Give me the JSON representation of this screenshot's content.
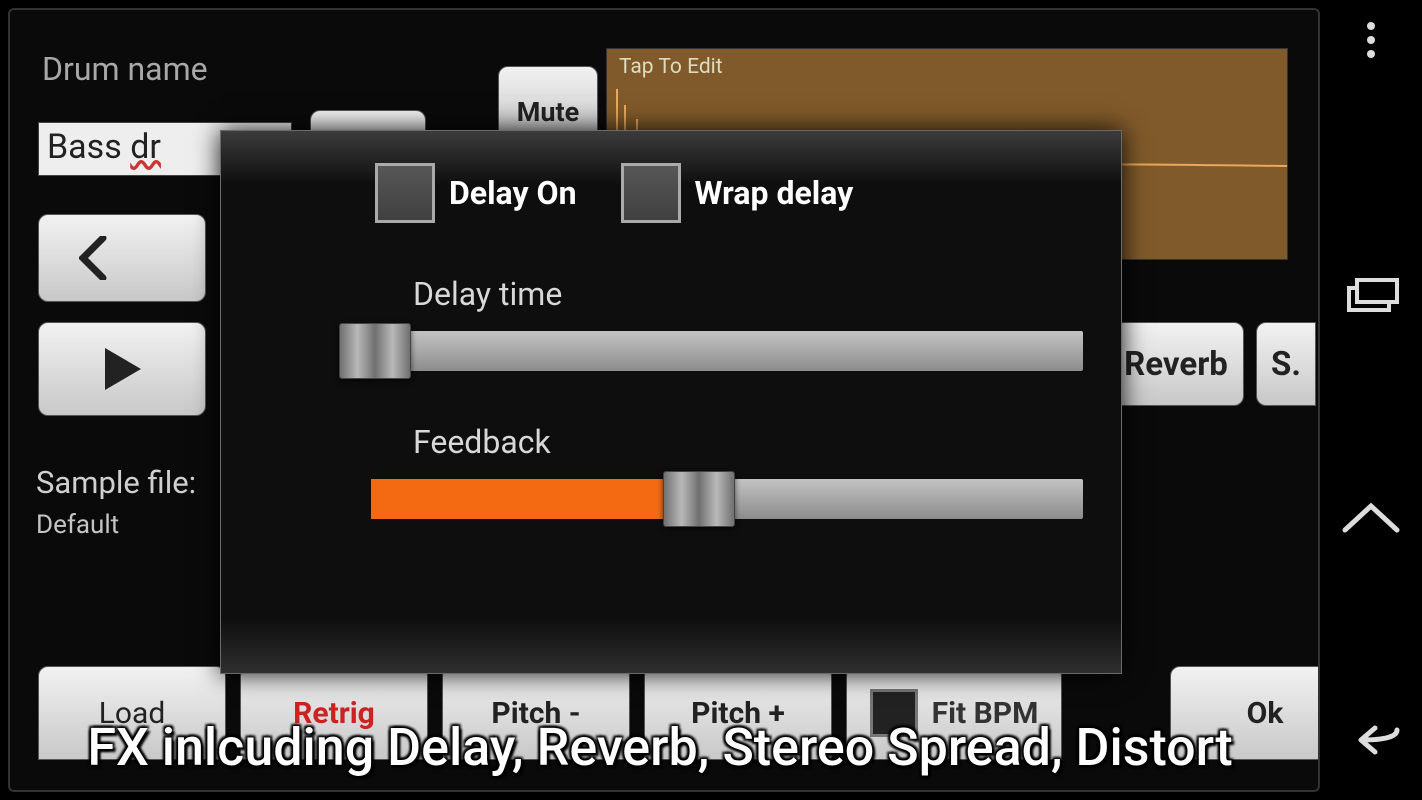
{
  "header": {
    "drum_name_label": "Drum name",
    "drum_name_value_pre": "Bass ",
    "drum_name_value_typo": "dr",
    "mute_label": "Mute"
  },
  "waveform": {
    "hint": "Tap To Edit"
  },
  "fx_tabs": {
    "reverb": "Reverb",
    "s": "S."
  },
  "sample": {
    "label": "Sample file:",
    "value": "Default"
  },
  "bottom": {
    "load": "Load",
    "retrig": "Retrig",
    "pitch_minus": "Pitch -",
    "pitch_plus": "Pitch +",
    "fit_bpm": "Fit BPM",
    "ok": "Ok"
  },
  "dialog": {
    "delay_on": "Delay On",
    "wrap_delay": "Wrap delay",
    "delay_time_label": "Delay time",
    "feedback_label": "Feedback",
    "delay_time_value": 0,
    "feedback_value": 46
  },
  "caption": "FX inlcuding Delay, Reverb, Stereo Spread, Distort"
}
